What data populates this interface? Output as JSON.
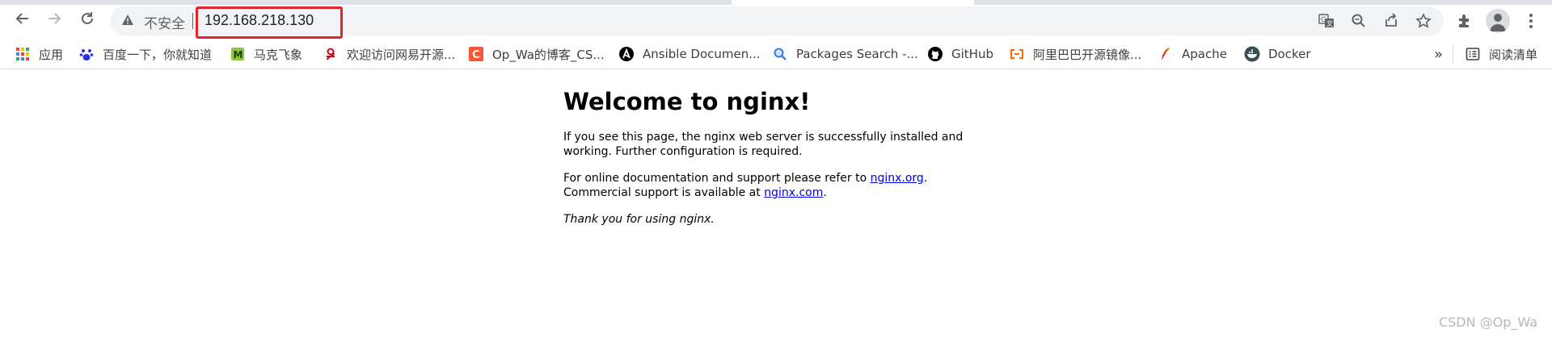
{
  "browser": {
    "address": {
      "security_label": "不安全",
      "url": "192.168.218.130"
    },
    "icons": {
      "back": "back-arrow-icon",
      "forward": "forward-arrow-icon",
      "reload": "reload-icon",
      "translate": "translate-icon",
      "zoom": "zoom-icon",
      "share": "share-icon",
      "bookmark": "star-icon",
      "extensions": "puzzle-icon",
      "profile": "avatar-icon",
      "menu": "kebab-menu-icon"
    }
  },
  "bookmarks": {
    "items": [
      {
        "label": "应用",
        "icon": "apps-grid-icon"
      },
      {
        "label": "百度一下，你就知道",
        "icon": "baidu-paw-icon"
      },
      {
        "label": "马克飞象",
        "icon": "maxiang-icon"
      },
      {
        "label": "欢迎访问网易开源...",
        "icon": "netease-icon"
      },
      {
        "label": "Op_Wa的博客_CS...",
        "icon": "csdn-icon"
      },
      {
        "label": "Ansible Documen...",
        "icon": "ansible-icon"
      },
      {
        "label": "Packages Search -...",
        "icon": "search-icon"
      },
      {
        "label": "GitHub",
        "icon": "github-icon"
      },
      {
        "label": "阿里巴巴开源镜像...",
        "icon": "aliyun-icon"
      },
      {
        "label": "Apache",
        "icon": "apache-feather-icon"
      },
      {
        "label": "Docker",
        "icon": "docker-icon"
      }
    ],
    "overflow": "»",
    "reading_list": "阅读清单"
  },
  "page": {
    "heading": "Welcome to nginx!",
    "p1": "If you see this page, the nginx web server is successfully installed and working. Further configuration is required.",
    "p2_prefix": "For online documentation and support please refer to ",
    "p2_link1": "nginx.org",
    "p2_mid": ".",
    "p2_line2_prefix": "Commercial support is available at ",
    "p2_link2": "nginx.com",
    "p2_end": ".",
    "p3": "Thank you for using nginx."
  },
  "watermark": "CSDN @Op_Wa",
  "colors": {
    "highlight": "#e0242b",
    "link": "#0000ee"
  }
}
